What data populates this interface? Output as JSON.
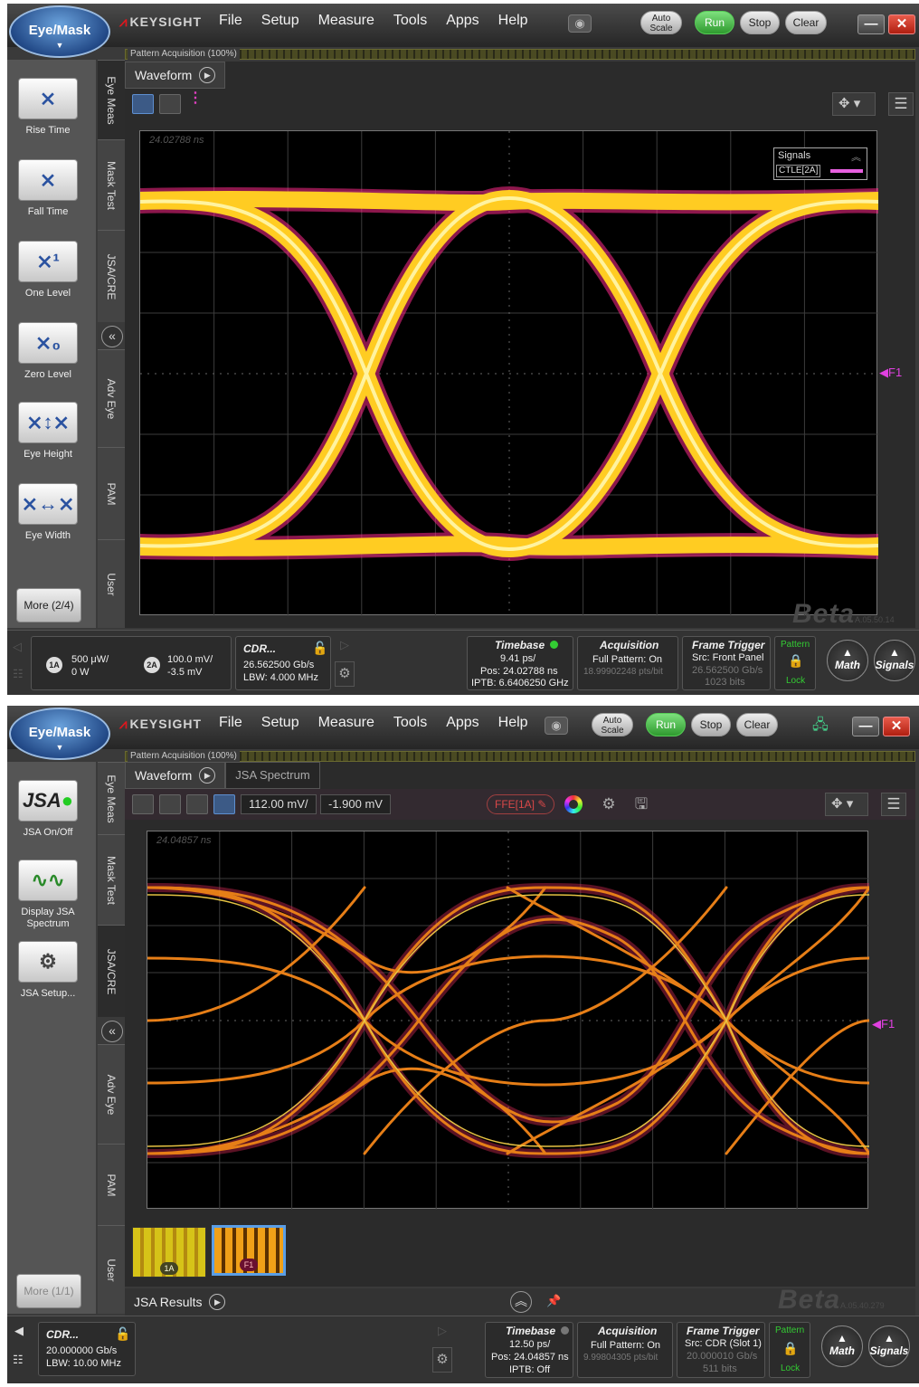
{
  "panel1": {
    "eyemask": "Eye/Mask",
    "brand": "KEYSIGHT",
    "menu": [
      "File",
      "Setup",
      "Measure",
      "Tools",
      "Apps",
      "Help"
    ],
    "buttons": {
      "autoscale": "Auto Scale",
      "run": "Run",
      "stop": "Stop",
      "clear": "Clear"
    },
    "progress": "Pattern Acquisition (100%)",
    "tools": [
      {
        "label": "Rise Time",
        "icon": "rise-time-icon"
      },
      {
        "label": "Fall Time",
        "icon": "fall-time-icon"
      },
      {
        "label": "One Level",
        "icon": "one-level-icon"
      },
      {
        "label": "Zero Level",
        "icon": "zero-level-icon"
      },
      {
        "label": "Eye Height",
        "icon": "eye-height-icon"
      },
      {
        "label": "Eye Width",
        "icon": "eye-width-icon"
      }
    ],
    "more": "More (2/4)",
    "vtabs": [
      "Eye Meas",
      "Mask Test",
      "JSA/CRE",
      "Adv Eye",
      "PAM",
      "User"
    ],
    "tab": "Waveform",
    "timestamp": "24.02788 ns",
    "legend": {
      "title": "Signals",
      "signal": "CTLE[2A]"
    },
    "marker": "F1",
    "beta": "Beta",
    "version": "A.05.50.14",
    "bottom": {
      "ch1": {
        "chip": "1A",
        "scale": "500 μW/",
        "offset": "0 W"
      },
      "ch2": {
        "chip": "2A",
        "scale": "100.0 mV/",
        "offset": "-3.5 mV"
      },
      "cdr": {
        "title": "CDR...",
        "rate": "26.562500 Gb/s",
        "lbw": "LBW: 4.000 MHz"
      },
      "timebase": {
        "title": "Timebase",
        "scale": "9.41 ps/",
        "pos": "Pos: 24.02788 ns",
        "iptb": "IPTB: 6.6406250 GHz"
      },
      "acquisition": {
        "title": "Acquisition",
        "pattern": "Full Pattern: On",
        "pts": "18.99902248 pts/bit"
      },
      "trigger": {
        "title": "Frame Trigger",
        "src": "Src: Front Panel",
        "rate": "26.562500 Gb/s",
        "bits": "1023 bits"
      },
      "pattern": {
        "title": "Pattern",
        "lock": "Lock"
      },
      "math": "Math",
      "signals": "Signals"
    }
  },
  "panel2": {
    "eyemask": "Eye/Mask",
    "brand": "KEYSIGHT",
    "menu": [
      "File",
      "Setup",
      "Measure",
      "Tools",
      "Apps",
      "Help"
    ],
    "buttons": {
      "autoscale": "Auto Scale",
      "run": "Run",
      "stop": "Stop",
      "clear": "Clear"
    },
    "progress": "Pattern Acquisition (100%)",
    "tools": [
      {
        "label": "JSA On/Off",
        "icon": "jsa-toggle-icon"
      },
      {
        "label": "Display JSA Spectrum",
        "icon": "jsa-spectrum-icon"
      },
      {
        "label": "JSA Setup...",
        "icon": "jsa-setup-icon"
      }
    ],
    "more": "More (1/1)",
    "vtabs": [
      "Eye Meas",
      "Mask Test",
      "JSA/CRE",
      "Adv Eye",
      "PAM",
      "User"
    ],
    "tabs": [
      "Waveform",
      "JSA Spectrum"
    ],
    "scale": "112.00 mV/",
    "offset": "-1.900 mV",
    "ffe": "FFE[1A]",
    "timestamp": "24.04857 ns",
    "marker": "F1",
    "thumbs": [
      "1A",
      "F1"
    ],
    "results": "JSA Results",
    "beta": "Beta",
    "version": "A.05.40.279",
    "bottom": {
      "cdr": {
        "title": "CDR...",
        "rate": "20.000000 Gb/s",
        "lbw": "LBW: 10.00 MHz"
      },
      "timebase": {
        "title": "Timebase",
        "scale": "12.50 ps/",
        "pos": "Pos: 24.04857 ns",
        "iptb": "IPTB: Off"
      },
      "acquisition": {
        "title": "Acquisition",
        "pattern": "Full Pattern: On",
        "pts": "9.99804305 pts/bit"
      },
      "trigger": {
        "title": "Frame Trigger",
        "src": "Src: CDR (Slot 1)",
        "rate": "20.000010 Gb/s",
        "bits": "511 bits"
      },
      "pattern": {
        "title": "Pattern",
        "lock": "Lock"
      },
      "math": "Math",
      "signals": "Signals"
    }
  }
}
